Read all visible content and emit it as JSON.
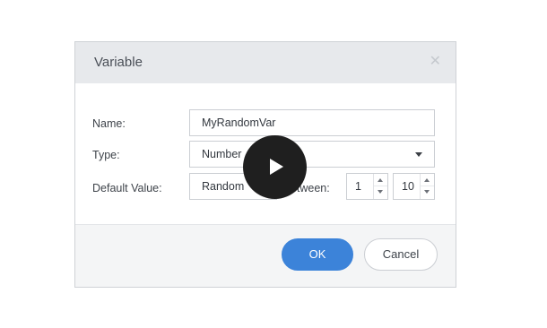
{
  "dialog": {
    "title": "Variable",
    "close_icon": "close-icon"
  },
  "form": {
    "name_label": "Name:",
    "name_value": "MyRandomVar",
    "type_label": "Type:",
    "type_value": "Number",
    "default_label": "Default Value:",
    "default_value": "Random",
    "between_label": "between:",
    "min_value": "1",
    "max_value": "10"
  },
  "buttons": {
    "ok": "OK",
    "cancel": "Cancel"
  },
  "overlay": {
    "icon": "play-icon"
  },
  "colors": {
    "accent": "#3c83d9",
    "header_bg": "#e7e9ec",
    "footer_bg": "#f4f5f6",
    "overlay": "#1f1f1f"
  }
}
